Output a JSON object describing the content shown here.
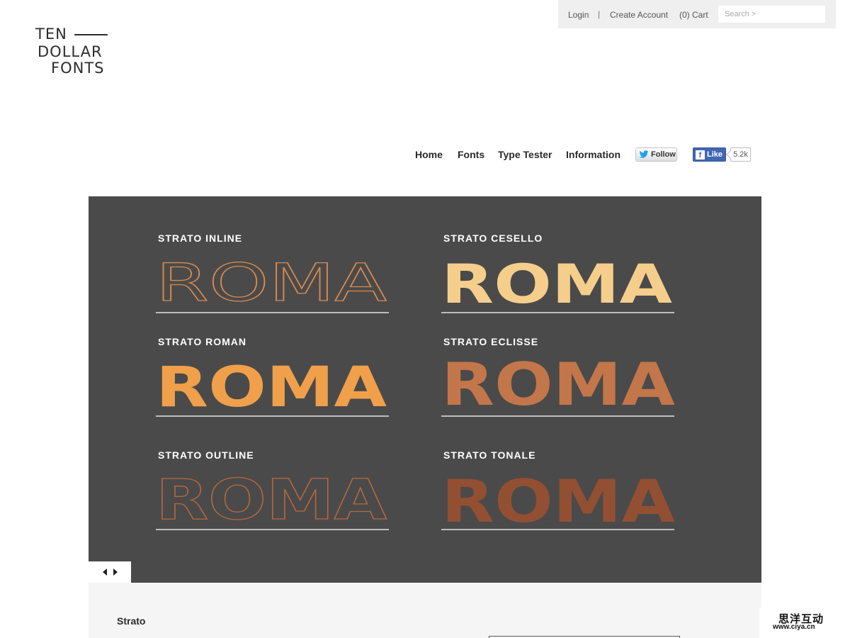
{
  "brand": {
    "logo_lines": [
      "TEN",
      "DOLLAR",
      "FONTS"
    ]
  },
  "utility": {
    "login": "Login",
    "separator": "|",
    "create_account": "Create Account",
    "cart": "(0) Cart",
    "search_placeholder": "Search >"
  },
  "nav": {
    "items": [
      {
        "label": "Home"
      },
      {
        "label": "Fonts"
      },
      {
        "label": "Type Tester"
      },
      {
        "label": "Information"
      }
    ],
    "twitter_label": "Follow",
    "facebook_label": "Like",
    "facebook_icon_letter": "f",
    "facebook_count": "5.2k"
  },
  "hero": {
    "sample_word": "ROMA",
    "specimens": [
      {
        "label": "STRATO INLINE",
        "style": "inline",
        "color": "#d88a4f"
      },
      {
        "label": "STRATO CESELLO",
        "style": "cesello",
        "color": "#f5ce8c"
      },
      {
        "label": "STRATO ROMAN",
        "style": "roman",
        "color": "#f0a04b"
      },
      {
        "label": "STRATO ECLISSE",
        "style": "eclisse",
        "color": "#c9784a"
      },
      {
        "label": "STRATO OUTLINE",
        "style": "outline",
        "color": "#b8683c"
      },
      {
        "label": "STRATO TONALE",
        "style": "tonale",
        "color": "#a0502e"
      }
    ]
  },
  "family": {
    "name": "Strato"
  },
  "watermark": {
    "chinese": "思洋互动",
    "url": "www.ciya.cn"
  },
  "colors": {
    "hero_background": "#4a4a4a",
    "panel_background": "#f5f5f5",
    "facebook_blue": "#4267b2",
    "twitter_blue": "#1da1f2"
  }
}
